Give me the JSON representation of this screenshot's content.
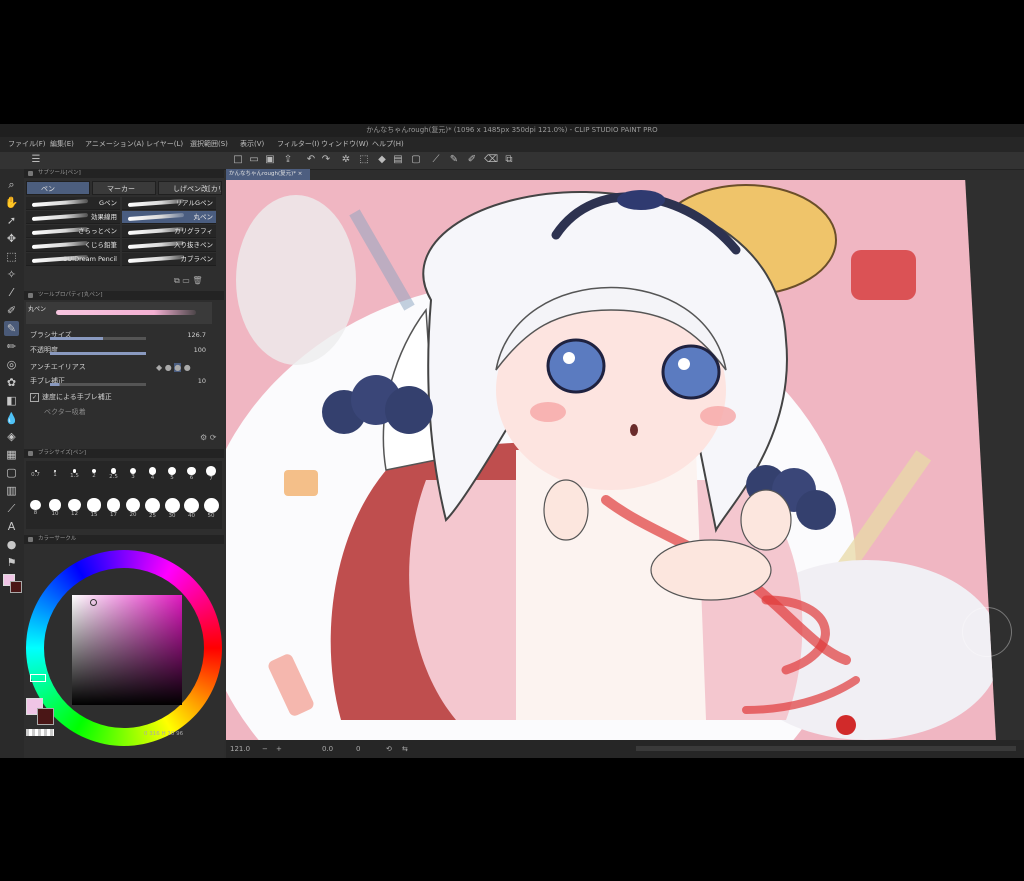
{
  "window": {
    "title": "かんなちゃんrough(复元)* (1096 x 1485px 350dpi 121.0%) - CLIP STUDIO PAINT PRO"
  },
  "menu": [
    "ファイル(F)",
    "編集(E)",
    "アニメーション(A)",
    "レイヤー(L)",
    "選択範囲(S)",
    "表示(V)",
    "フィルター(I)",
    "ウィンドウ(W)",
    "ヘルプ(H)"
  ],
  "canvas_tab": "かんなちゃんrough(复元)*",
  "subtool_panel": {
    "header": "サブツール[ペン]",
    "tabs": [
      "ペン",
      "マーカー",
      "しげペン改[カリ"
    ],
    "brushes": [
      {
        "label": "Gペン",
        "active": false
      },
      {
        "label": "リアルGペン",
        "active": false
      },
      {
        "label": "効果線用",
        "active": false
      },
      {
        "label": "丸ペン",
        "active": true
      },
      {
        "label": "さらっとペン",
        "active": false
      },
      {
        "label": "カリグラフィ",
        "active": false
      },
      {
        "label": "くじら鉛筆",
        "active": false
      },
      {
        "label": "入り抜きペン",
        "active": false
      },
      {
        "label": "SUIDream Pencil",
        "active": false
      },
      {
        "label": "カブラペン",
        "active": false
      }
    ]
  },
  "property_panel": {
    "header": "ツールプロパティ[丸ペン]",
    "brush_name": "丸ペン",
    "rows": [
      {
        "label": "ブラシサイズ",
        "value": "126.7",
        "fill": 0.55
      },
      {
        "label": "不透明度",
        "value": "100",
        "fill": 1.0
      },
      {
        "label": "アンチエイリアス",
        "value": ""
      },
      {
        "label": "手ブレ補正",
        "value": "10",
        "fill": 0.1
      },
      {
        "label": "速度による手ブレ補正",
        "value": ""
      },
      {
        "label": "ベクター吸着",
        "value": ""
      }
    ]
  },
  "brush_size_panel": {
    "header": "ブラシサイズ[ペン]",
    "sizes": [
      "0.7",
      "1",
      "1.5",
      "2",
      "2.5",
      "3",
      "4",
      "5",
      "6",
      "7",
      "8",
      "10",
      "12",
      "15",
      "17",
      "20",
      "25",
      "30",
      "40",
      "50"
    ]
  },
  "color_panel": {
    "header": "カラーサークル",
    "main_color": "#f0c5e6",
    "sub_color": "#4a1616",
    "readout": "0 316 H 10 96"
  },
  "status_bar": {
    "zoom": "121.0",
    "angle": "0.0",
    "frame": "0"
  },
  "colors": {
    "accent": "#4a5d80",
    "background": "#2d2d2d",
    "canvas_bg": "#f0b6c2"
  }
}
